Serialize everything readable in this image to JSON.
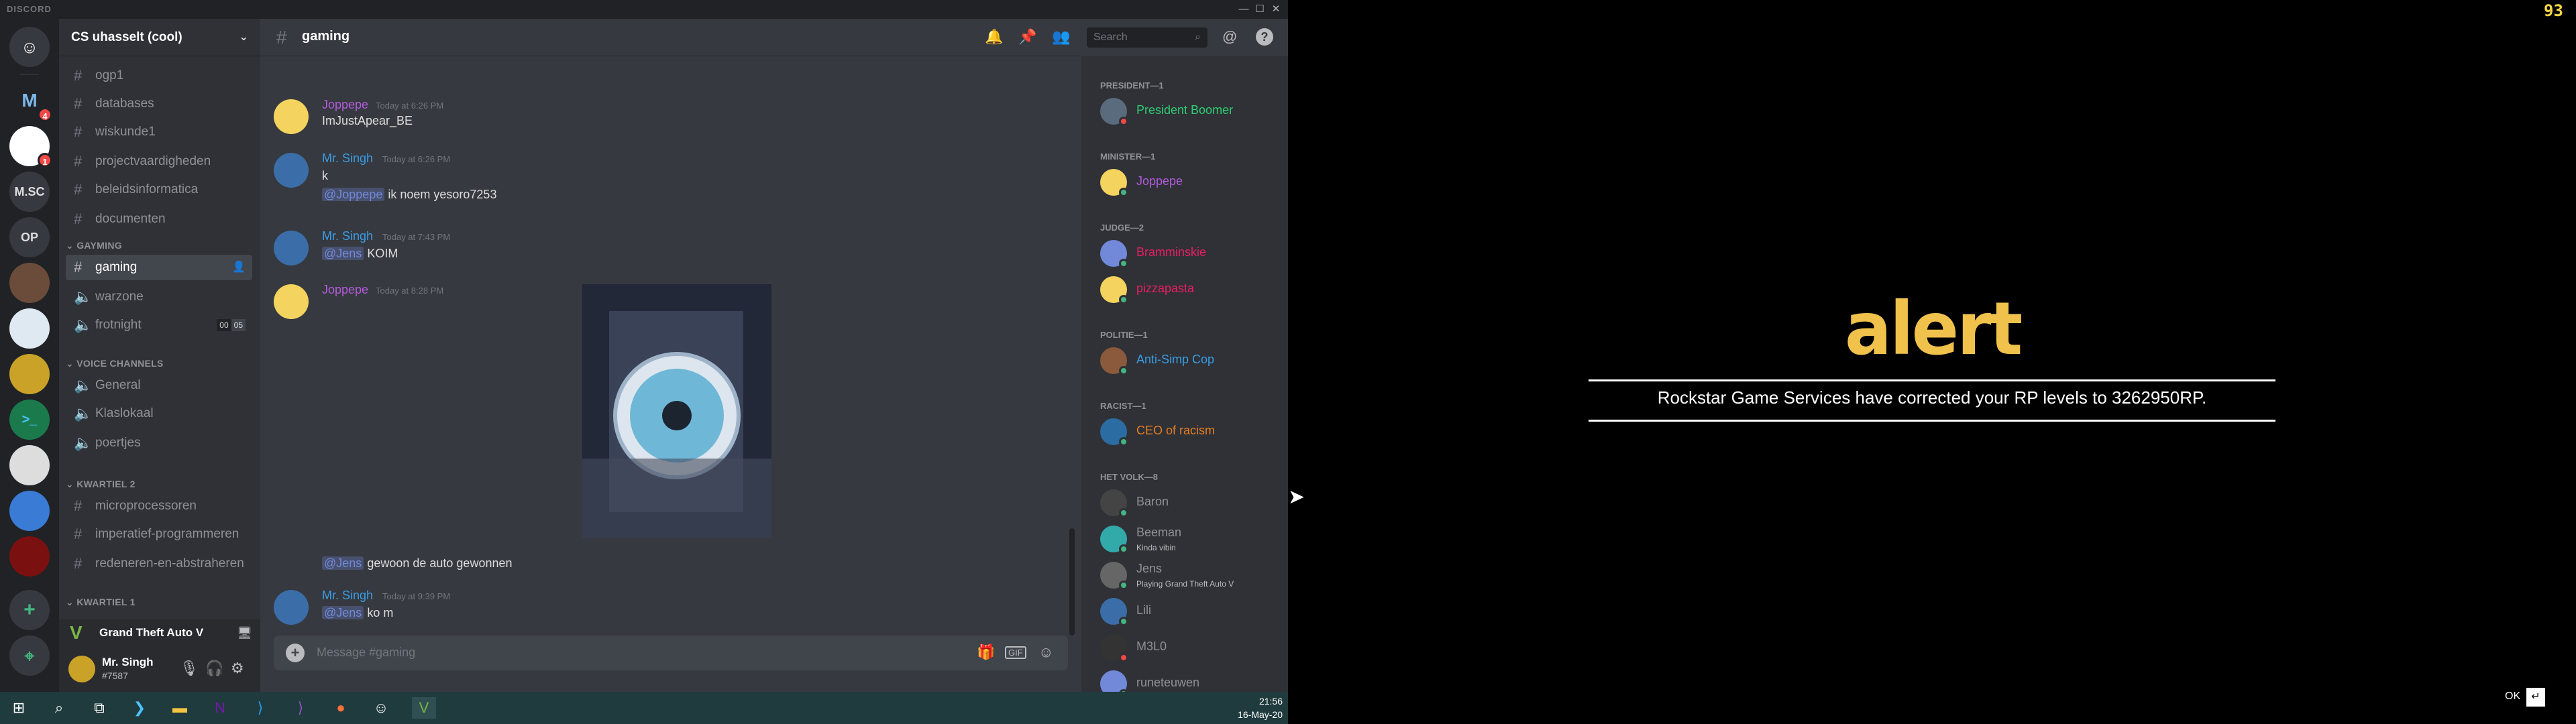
{
  "window": {
    "logo": "DISCORD",
    "minimize": "—",
    "maximize": "☐",
    "close": "✕"
  },
  "servers": {
    "home_icon": "discord-logo-icon",
    "items": [
      "M",
      "",
      "",
      "M.SC",
      "OP",
      "",
      "",
      "",
      "",
      "",
      "",
      ""
    ],
    "badges": [
      "4",
      "1"
    ],
    "add": "+",
    "explore": "⌖"
  },
  "guild": {
    "name": "CS uhasselt (cool)",
    "chevron": "⌄"
  },
  "channels": {
    "text_top": [
      "ogp1",
      "databases",
      "wiskunde1",
      "projectvaardigheden",
      "beleidsinformatica",
      "documenten"
    ],
    "cat_gayming": "GAYMING",
    "gayming": [
      {
        "name": "gaming",
        "type": "text"
      },
      {
        "name": "warzone",
        "type": "voice"
      },
      {
        "name": "frotnight",
        "type": "voice",
        "counts": [
          "00",
          "05"
        ]
      }
    ],
    "cat_voice": "VOICE CHANNELS",
    "voice": [
      "General",
      "Klaslokaal",
      "poertjes"
    ],
    "cat_kw2": "KWARTIEL 2",
    "kw2": [
      "microprocessoren",
      "imperatief-programmeren",
      "redeneren-en-abstraheren"
    ],
    "cat_kw1": "KWARTIEL 1"
  },
  "game_bar": {
    "label": "Grand Theft Auto V"
  },
  "user": {
    "name": "Mr. Singh",
    "tag": "#7587"
  },
  "chat": {
    "channel": "gaming",
    "search_placeholder": "Search",
    "composer_placeholder": "Message #gaming",
    "messages": [
      {
        "author": "Joppepe",
        "color": "#b35cdc",
        "time": "Today at 6:26 PM",
        "lines": [
          "ImJustApear_BE"
        ]
      },
      {
        "author": "Mr. Singh",
        "color": "#3b9ce3",
        "time": "Today at 6:26 PM",
        "lines": [
          "k"
        ],
        "mention_line": {
          "mention": "@Joppepe",
          "text": "ik noem yesoro7253"
        }
      },
      {
        "author": "Mr. Singh",
        "color": "#3b9ce3",
        "time": "Today at 7:43 PM",
        "mention_line": {
          "mention": "@Jens",
          "text": "KOIM"
        }
      },
      {
        "author": "Joppepe",
        "color": "#b35cdc",
        "time": "Today at 8:28 PM",
        "mention_line": {
          "mention": "@Jens",
          "text": "gewoon de auto gewonnen"
        }
      },
      {
        "author": "Mr. Singh",
        "color": "#3b9ce3",
        "time": "Today at 9:39 PM",
        "mention_line": {
          "mention": "@Jens",
          "text": "ko m"
        }
      }
    ]
  },
  "members": {
    "roles": [
      {
        "title": "PRESIDENT—1",
        "members": [
          {
            "name": "President Boomer",
            "color": "#2ecc71",
            "status": "dnd"
          }
        ]
      },
      {
        "title": "MINISTER—1",
        "members": [
          {
            "name": "Joppepe",
            "color": "#b35cdc",
            "status": "online"
          }
        ]
      },
      {
        "title": "JUDGE—2",
        "members": [
          {
            "name": "Bramminskie",
            "color": "#e91e63",
            "status": "online"
          },
          {
            "name": "pizzapasta",
            "color": "#e91e63",
            "status": "online"
          }
        ]
      },
      {
        "title": "POLITIE—1",
        "members": [
          {
            "name": "Anti-Simp Cop",
            "color": "#3b9ce3",
            "status": "online"
          }
        ]
      },
      {
        "title": "RACIST—1",
        "members": [
          {
            "name": "CEO of racism",
            "color": "#e67e22",
            "status": "online"
          }
        ]
      },
      {
        "title": "HET VOLK—8",
        "members": [
          {
            "name": "Baron",
            "color": "#8e9297",
            "status": "online"
          },
          {
            "name": "Beeman",
            "color": "#8e9297",
            "status": "online",
            "sub": "Kinda vibin"
          },
          {
            "name": "Jens",
            "color": "#8e9297",
            "status": "online",
            "sub": "Playing Grand Theft Auto V"
          },
          {
            "name": "Lili",
            "color": "#8e9297",
            "status": "online"
          },
          {
            "name": "M3L0",
            "color": "#8e9297",
            "status": "dnd"
          },
          {
            "name": "runeteuwen",
            "color": "#8e9297",
            "status": "online"
          }
        ]
      }
    ]
  },
  "gta": {
    "alert_word": "alert",
    "message": "Rockstar Game Services have corrected your RP levels to 3262950RP.",
    "fps": "93",
    "ok_label": "OK",
    "ok_key": "↵"
  },
  "taskbar": {
    "time": "21:56",
    "date": "16-May-20"
  }
}
